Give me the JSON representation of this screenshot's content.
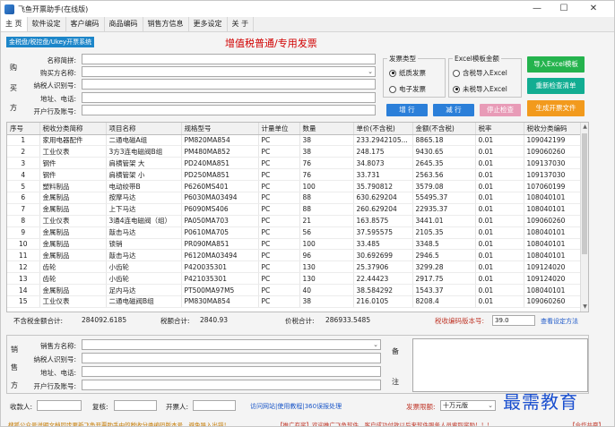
{
  "window": {
    "title": "飞鱼开票助手(在线版)",
    "min": "—",
    "max": "☐",
    "close": "✕"
  },
  "menu": [
    "主 页",
    "软件设定",
    "客户编码",
    "商品编码",
    "销售方信息",
    "更多设定",
    "关 于"
  ],
  "mode_badge": "金税盘/税控盘/Ukey开票系统",
  "page_title": "增值税普通/专用发票",
  "buyer": {
    "side_chars": [
      "购",
      "买",
      "方"
    ],
    "fields": [
      {
        "label": "名称简拼:",
        "value": ""
      },
      {
        "label": "购买方名称:",
        "value": ""
      },
      {
        "label": "纳税人识别号:",
        "value": ""
      },
      {
        "label": "地址、电话:",
        "value": ""
      },
      {
        "label": "开户行及账号:",
        "value": ""
      }
    ]
  },
  "invoice_type": {
    "title": "发票类型",
    "options": [
      "纸质发票",
      "电子发票"
    ],
    "selected": 0
  },
  "excel_amount": {
    "title": "Excel模板金额",
    "options": [
      "含税导入Excel",
      "未税导入Excel"
    ],
    "selected": 1
  },
  "buttons": {
    "add_row": "增 行",
    "del_row": "减 行",
    "stop_check": "停止检查",
    "import_excel": "导入Excel模板",
    "recheck": "重新检查清单",
    "generate": "生成开票文件"
  },
  "table": {
    "headers": [
      "序号",
      "税收分类简称",
      "项目名称",
      "规格型号",
      "计量单位",
      "数量",
      "单价(不含税)",
      "金额(不含税)",
      "税率",
      "税收分类编码"
    ],
    "rows": [
      [
        "1",
        "家用电器配件",
        "二通电磁A组",
        "PM820MA854",
        "PC",
        "38",
        "233.2942105...",
        "8865.18",
        "0.01",
        "109042199"
      ],
      [
        "2",
        "工业仪表",
        "3方3连电磁阀B组",
        "PM480MA852",
        "PC",
        "38",
        "248.175",
        "9430.65",
        "0.01",
        "109060260"
      ],
      [
        "3",
        "钢件",
        "肩横管架 大",
        "PD240MA851",
        "PC",
        "76",
        "34.8073",
        "2645.35",
        "0.01",
        "109137030"
      ],
      [
        "4",
        "钢件",
        "肩横管架 小",
        "PD250MA851",
        "PC",
        "76",
        "33.731",
        "2563.56",
        "0.01",
        "109137030"
      ],
      [
        "5",
        "塑料制品",
        "电动绞带B",
        "P6260MS401",
        "PC",
        "100",
        "35.790812",
        "3579.08",
        "0.01",
        "107060199"
      ],
      [
        "6",
        "金属制品",
        "按摩马达",
        "P6030MA03494",
        "PC",
        "88",
        "630.629204",
        "55495.37",
        "0.01",
        "108040101"
      ],
      [
        "7",
        "金属制品",
        "上下马达",
        "P6090MS406",
        "PC",
        "88",
        "260.629204",
        "22935.37",
        "0.01",
        "108040101"
      ],
      [
        "8",
        "工业仪表",
        "3通4连电磁阀（组）",
        "PA050MA703",
        "PC",
        "21",
        "163.8575",
        "3441.01",
        "0.01",
        "109060260"
      ],
      [
        "9",
        "金属制品",
        "敲击马达",
        "P0610MA705",
        "PC",
        "56",
        "37.595575",
        "2105.35",
        "0.01",
        "108040101"
      ],
      [
        "10",
        "金属制品",
        "锁销",
        "PR090MA851",
        "PC",
        "100",
        "33.485",
        "3348.5",
        "0.01",
        "108040101"
      ],
      [
        "11",
        "金属制品",
        "敲击马达",
        "P6120MA03494",
        "PC",
        "96",
        "30.692699",
        "2946.5",
        "0.01",
        "108040101"
      ],
      [
        "12",
        "齿轮",
        "小齿轮",
        "P420035301",
        "PC",
        "130",
        "25.37906",
        "3299.28",
        "0.01",
        "109124020"
      ],
      [
        "13",
        "齿轮",
        "小齿轮",
        "P421035301",
        "PC",
        "130",
        "22.44423",
        "2917.75",
        "0.01",
        "109124020"
      ],
      [
        "14",
        "金属制品",
        "足内马达",
        "PT500MA97M5",
        "PC",
        "40",
        "38.584292",
        "1543.37",
        "0.01",
        "108040101"
      ],
      [
        "15",
        "工业仪表",
        "二通电磁阀B组",
        "PM830MA854",
        "PC",
        "38",
        "216.0105",
        "8208.4",
        "0.01",
        "109060260"
      ]
    ]
  },
  "totals": {
    "amount_label": "不含税金额合计:",
    "amount": "284092.6185",
    "tax_label": "税额合计:",
    "tax": "2840.93",
    "total_label": "价税合计:",
    "total": "286933.5485",
    "code_version_label": "税收编码版本号:",
    "code_version": "39.0",
    "settings_link": "查看设定方法"
  },
  "seller": {
    "side_chars": [
      "销",
      "售",
      "方"
    ],
    "fields": [
      {
        "label": "销售方名称:",
        "value": ""
      },
      {
        "label": "纳税人识别号:",
        "value": ""
      },
      {
        "label": "地址、电话:",
        "value": ""
      },
      {
        "label": "开户行及账号:",
        "value": ""
      }
    ],
    "remark_chars": [
      "备",
      "注"
    ]
  },
  "people": {
    "payee": "收款人:",
    "reviewer": "复核:",
    "drawer": "开票人:",
    "links": "访问网站|使用教程|360误报处理",
    "limit_label": "发票限额:",
    "limit_value": "十万元版"
  },
  "footer": {
    "left": "搜狐公众号说明文档同步更新飞鱼开票助手中的税收分类编码版本号，避免导入出错！",
    "mid": "【推广有奖】欢迎推广飞鱼软件，客户成功付款以后来软件服务人员索取奖励！！！",
    "right": "【合作共赢】"
  },
  "watermark": "最需教育"
}
